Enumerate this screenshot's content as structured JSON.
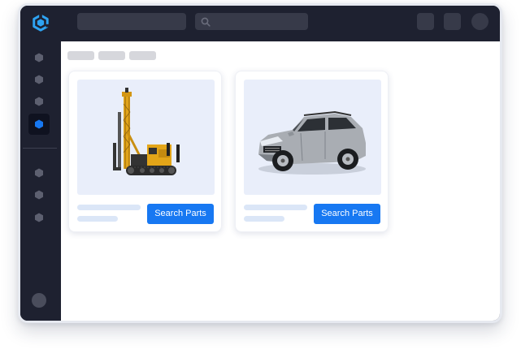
{
  "colors": {
    "frame": "#1e2130",
    "placeholder_dark": "#373a49",
    "accent": "#1778f2",
    "logo": "#2ea3f2",
    "card_image_bg": "#e9eefa",
    "skeleton_light": "#dbe6f7"
  },
  "topbar": {
    "logo_icon": "cube-logo-icon",
    "search_icon": "search-icon",
    "avatar_icon": "avatar-icon"
  },
  "sidebar": {
    "items": [
      {
        "icon": "hexagon-icon",
        "active": false
      },
      {
        "icon": "hexagon-icon",
        "active": false
      },
      {
        "icon": "hexagon-icon",
        "active": false
      },
      {
        "icon": "hexagon-icon",
        "active": true
      },
      {
        "icon": "hexagon-icon",
        "active": false
      },
      {
        "icon": "hexagon-icon",
        "active": false
      },
      {
        "icon": "hexagon-icon",
        "active": false
      }
    ]
  },
  "cards": [
    {
      "image": "drilling-rig-image",
      "button_label": "Search Parts"
    },
    {
      "image": "suv-car-image",
      "button_label": "Search Parts"
    }
  ]
}
